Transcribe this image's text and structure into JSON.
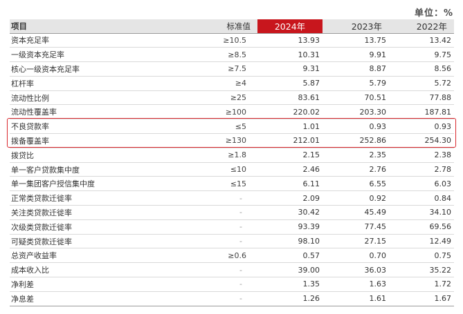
{
  "unit_label": "单位：%",
  "headers": {
    "name": "项目",
    "standard": "标准值",
    "y2024": "2024年",
    "y2023": "2023年",
    "y2022": "2022年"
  },
  "highlight_color": "#c8161d",
  "rows": [
    {
      "name": "资本充足率",
      "standard": "≥10.5",
      "y2024": "13.93",
      "y2023": "13.75",
      "y2022": "13.42"
    },
    {
      "name": "一级资本充足率",
      "standard": "≥8.5",
      "y2024": "10.31",
      "y2023": "9.91",
      "y2022": "9.75"
    },
    {
      "name": "核心一级资本充足率",
      "standard": "≥7.5",
      "y2024": "9.31",
      "y2023": "8.87",
      "y2022": "8.56"
    },
    {
      "name": "杠杆率",
      "standard": "≥4",
      "y2024": "5.87",
      "y2023": "5.79",
      "y2022": "5.72"
    },
    {
      "name": "流动性比例",
      "standard": "≥25",
      "y2024": "83.61",
      "y2023": "70.51",
      "y2022": "77.88"
    },
    {
      "name": "流动性覆盖率",
      "standard": "≥100",
      "y2024": "220.02",
      "y2023": "203.30",
      "y2022": "187.81"
    },
    {
      "name": "不良贷款率",
      "standard": "≤5",
      "y2024": "1.01",
      "y2023": "0.93",
      "y2022": "0.93"
    },
    {
      "name": "拨备覆盖率",
      "standard": "≥130",
      "y2024": "212.01",
      "y2023": "252.86",
      "y2022": "254.30"
    },
    {
      "name": "拨贷比",
      "standard": "≥1.8",
      "y2024": "2.15",
      "y2023": "2.35",
      "y2022": "2.38"
    },
    {
      "name": "单一客户贷款集中度",
      "standard": "≤10",
      "y2024": "2.46",
      "y2023": "2.76",
      "y2022": "2.78"
    },
    {
      "name": "单一集团客户授信集中度",
      "standard": "≤15",
      "y2024": "6.11",
      "y2023": "6.55",
      "y2022": "6.03"
    },
    {
      "name": "正常类贷款迁徙率",
      "standard": "-",
      "y2024": "2.09",
      "y2023": "0.92",
      "y2022": "0.84"
    },
    {
      "name": "关注类贷款迁徙率",
      "standard": "-",
      "y2024": "30.42",
      "y2023": "45.49",
      "y2022": "34.10"
    },
    {
      "name": "次级类贷款迁徙率",
      "standard": "-",
      "y2024": "93.39",
      "y2023": "77.45",
      "y2022": "69.56"
    },
    {
      "name": "可疑类贷款迁徙率",
      "standard": "-",
      "y2024": "98.10",
      "y2023": "27.15",
      "y2022": "12.49"
    },
    {
      "name": "总资产收益率",
      "standard": "≥0.6",
      "y2024": "0.57",
      "y2023": "0.70",
      "y2022": "0.75"
    },
    {
      "name": "成本收入比",
      "standard": "-",
      "y2024": "39.00",
      "y2023": "36.03",
      "y2022": "35.22"
    },
    {
      "name": "净利差",
      "standard": "-",
      "y2024": "1.35",
      "y2023": "1.63",
      "y2022": "1.72"
    },
    {
      "name": "净息差",
      "standard": "-",
      "y2024": "1.26",
      "y2023": "1.61",
      "y2022": "1.67"
    }
  ]
}
